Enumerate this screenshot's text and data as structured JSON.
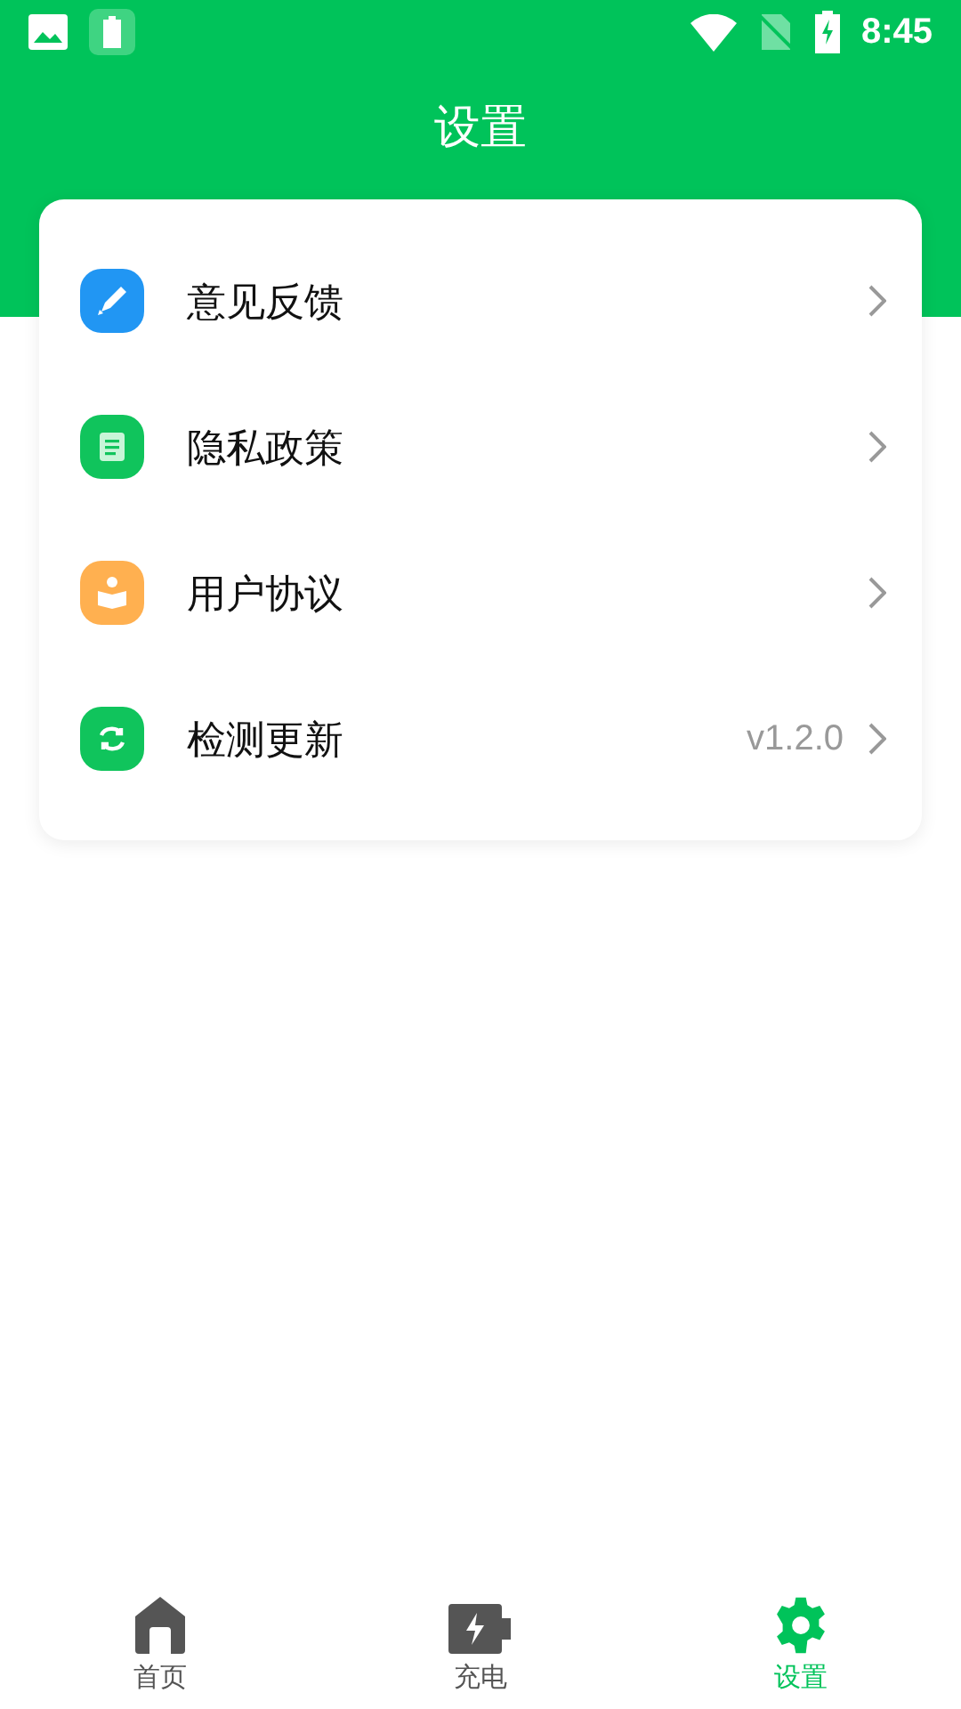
{
  "status_bar": {
    "time": "8:45"
  },
  "header": {
    "title": "设置"
  },
  "menu": [
    {
      "label": "意见反馈",
      "kind": "pencil",
      "color": "#2196f3"
    },
    {
      "label": "隐私政策",
      "kind": "document",
      "color": "#10c45c"
    },
    {
      "label": "用户协议",
      "kind": "reader",
      "color": "#ffb050"
    },
    {
      "label": "检测更新",
      "kind": "refresh",
      "color": "#10c45c",
      "value": "v1.2.0"
    }
  ],
  "bottom_nav": [
    {
      "label": "首页",
      "kind": "home",
      "selected": false
    },
    {
      "label": "充电",
      "kind": "battery",
      "selected": false
    },
    {
      "label": "设置",
      "kind": "gear",
      "selected": true
    }
  ]
}
